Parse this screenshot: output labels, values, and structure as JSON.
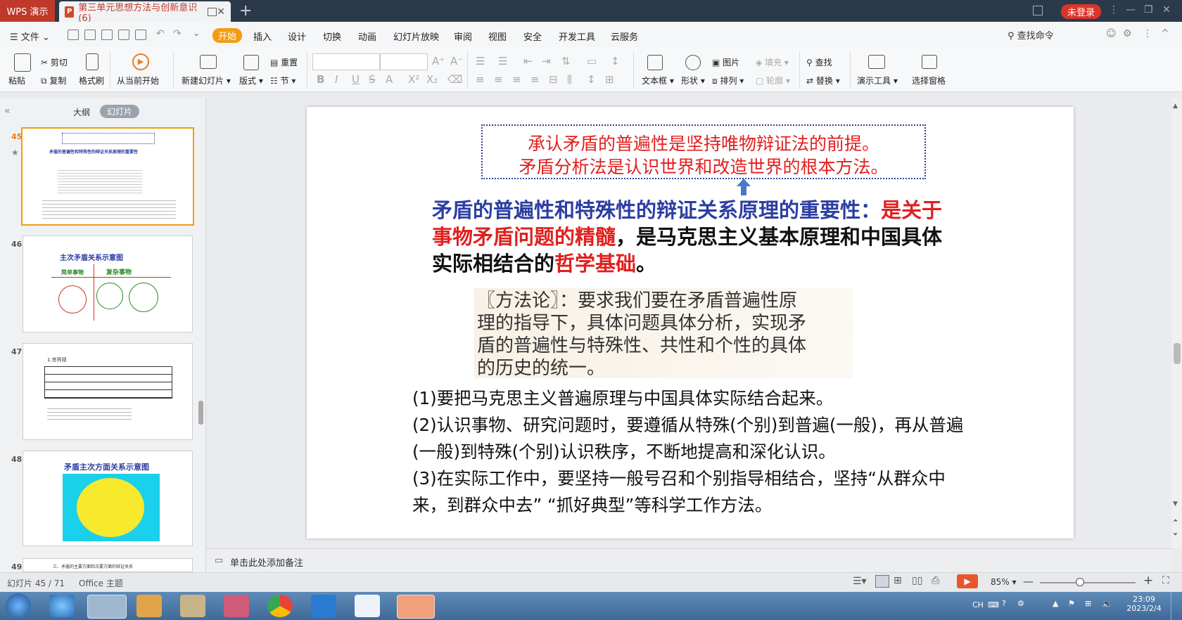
{
  "titlebar": {
    "app_tab": "WPS 演示",
    "doc_tab": "第三单元思想方法与创新意识(6)",
    "login": "未登录"
  },
  "menu": {
    "file": "文件",
    "items": [
      "开始",
      "插入",
      "设计",
      "切换",
      "动画",
      "幻灯片放映",
      "审阅",
      "视图",
      "安全",
      "开发工具",
      "云服务"
    ],
    "search": "查找命令"
  },
  "ribbon": {
    "paste": "粘贴",
    "cut": "剪切",
    "copy": "复制",
    "format_painter": "格式刷",
    "from_current": "从当前开始",
    "new_slide": "新建幻灯片",
    "layout": "版式",
    "reset": "重置",
    "section": "节",
    "textbox": "文本框",
    "shape": "形状",
    "picture": "图片",
    "arrange": "排列",
    "fill": "填充",
    "outline": "轮廓",
    "find": "查找",
    "replace": "替换",
    "present_tools": "演示工具",
    "select_pane": "选择窗格"
  },
  "leftpanel": {
    "tab_outline": "大纲",
    "tab_slides": "幻灯片",
    "thumbs": [
      {
        "num": "45",
        "title": "矛盾的普遍性和特殊性的辩证关系原理的重要性"
      },
      {
        "num": "46",
        "title": "主次矛盾关系示意图",
        "sub1": "简单事物",
        "sub2": "复杂事物"
      },
      {
        "num": "47",
        "title": "1.世界观"
      },
      {
        "num": "48",
        "title": "矛盾主次方面关系示意图"
      },
      {
        "num": "49",
        "title": "三、矛盾的主要方面和次要方面的辩证关系"
      }
    ]
  },
  "slide": {
    "box_line1": "承认矛盾的普遍性是坚持唯物辩证法的前提。",
    "box_line2": "矛盾分析法是认识世界和改造世界的根本方法。",
    "heading_a": "矛盾的普遍性和特殊性的辩证关系原理的重要性：",
    "heading_b": "是关于事物矛盾问题的精髓",
    "heading_c": "，是马克思主义基本原理和中国具体实际相结合的",
    "heading_d": "哲学基础",
    "heading_e": "。",
    "method_1": "〖方法论〗：要求我们要在矛盾普遍性原",
    "method_2": "理的指导下，具体问题具体分析，实现矛",
    "method_3": "盾的普遍性与特殊性、共性和个性的具体",
    "method_4": "的历史的统一。",
    "point1": "(1)要把马克思主义普遍原理与中国具体实际结合起来。",
    "point2a": "(2)认识事物、研究问题时，要遵循从特殊(个别)到普遍(一般)，再从普遍",
    "point2b": "(一般)到特殊(个别)认识秩序，不断地提高和深化认识。",
    "point3a": "(3)在实际工作中，要坚持一般号召和个别指导相结合，坚持“从群众中",
    "point3b": "来，到群众中去”  “抓好典型”等科学工作方法。"
  },
  "notes": {
    "placeholder": "单击此处添加备注"
  },
  "status": {
    "slide_count": "幻灯片 45 / 71",
    "theme": "Office 主题",
    "zoom": "85%"
  },
  "taskbar": {
    "lang": "CH",
    "time": "23:09",
    "date": "2023/2/4"
  },
  "colors": {
    "accent": "#f39c12",
    "wps_red": "#c0392b",
    "slide_red": "#e0201f",
    "slide_blue": "#2c3ea3"
  }
}
